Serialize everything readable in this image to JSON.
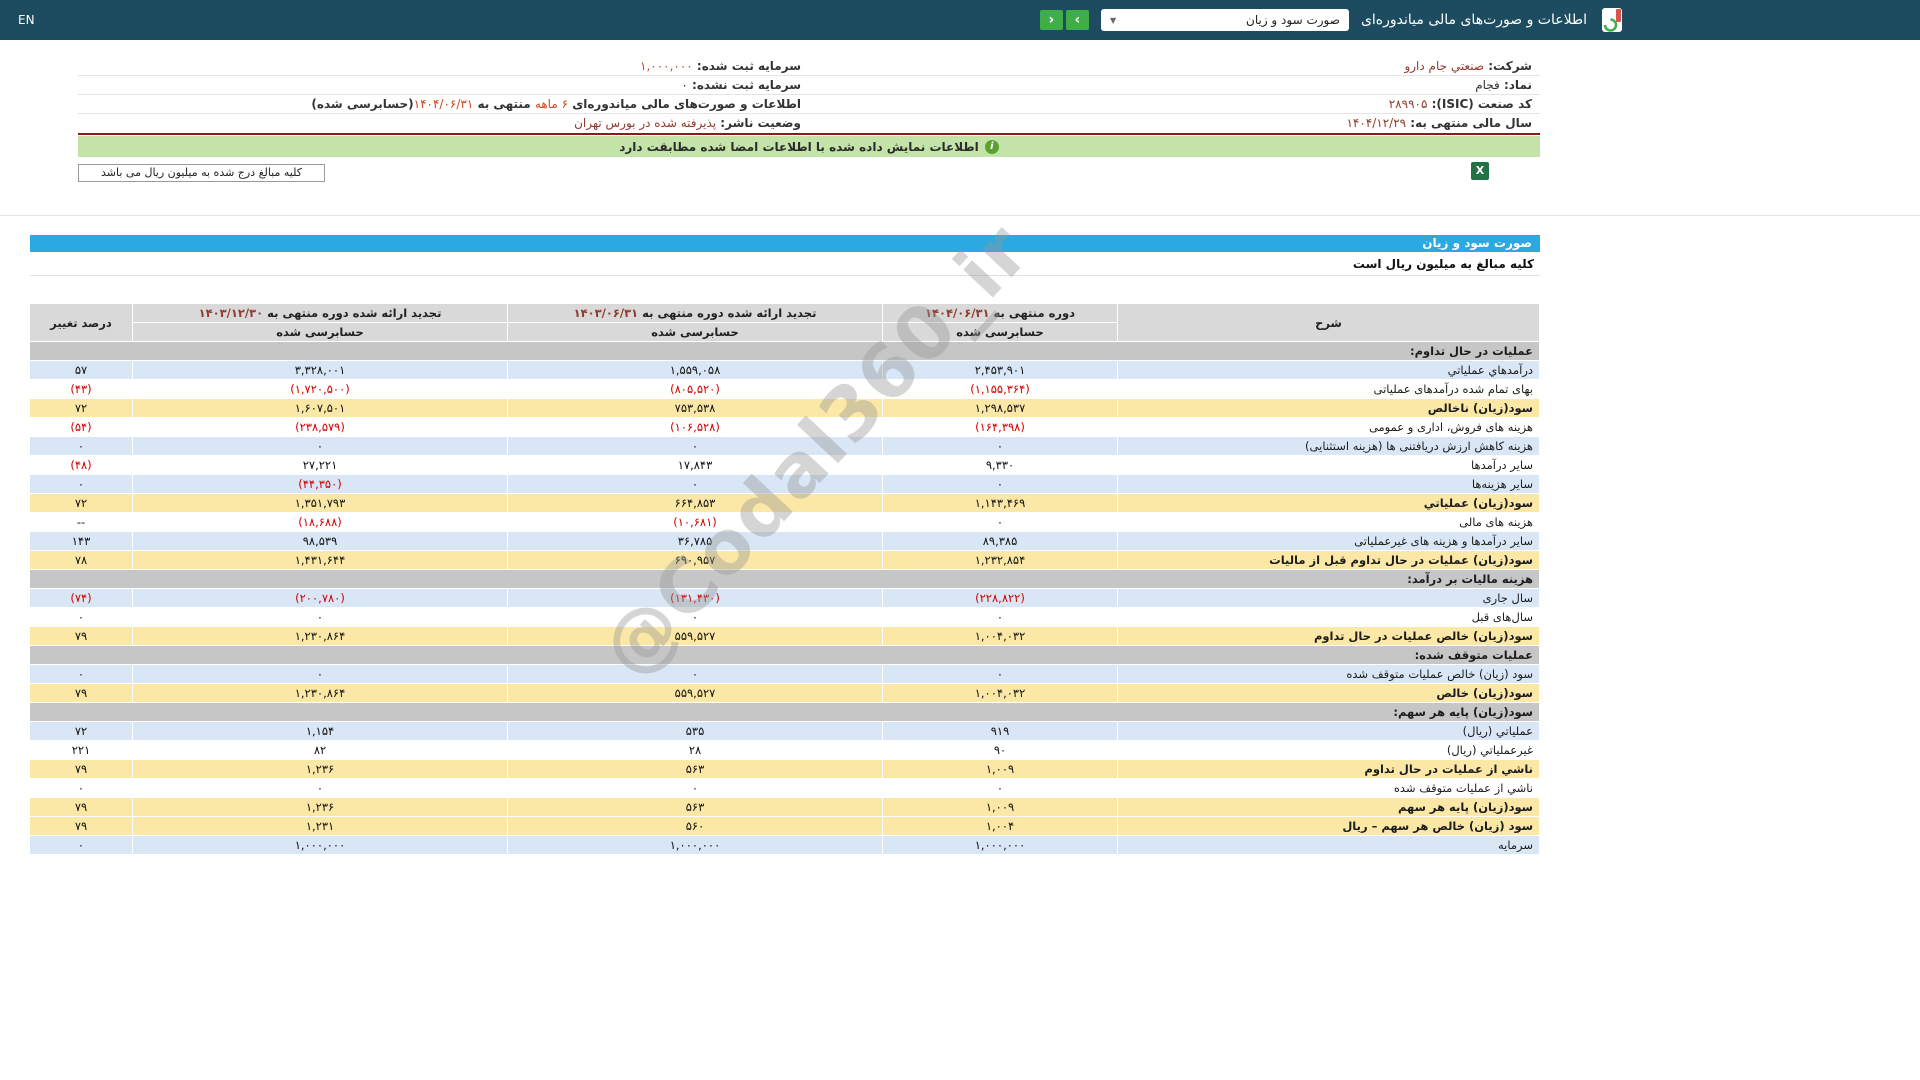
{
  "topbar": {
    "title": "اطلاعات و صورت‌های مالی میاندوره‌ای",
    "report_select_value": "صورت سود و زیان",
    "select_caret": "▼",
    "next_button": "›",
    "prev_button": "‹",
    "en_link": "EN"
  },
  "company_info": {
    "rows": [
      {
        "right": [
          {
            "text": "شرکت: ",
            "style": "label"
          },
          {
            "text": "صنعتي جام دارو",
            "style": "maroon"
          }
        ],
        "left": [
          {
            "text": "سرمایه ثبت شده: ",
            "style": "label"
          },
          {
            "text": "۱,۰۰۰,۰۰۰",
            "style": "orange"
          }
        ]
      },
      {
        "right": [
          {
            "text": "نماد: ",
            "style": "label"
          },
          {
            "text": "فجام",
            "style": "dark"
          }
        ],
        "left": [
          {
            "text": "سرمایه ثبت نشده: ",
            "style": "label"
          },
          {
            "text": "۰",
            "style": "dark"
          }
        ]
      },
      {
        "right": [
          {
            "text": "کد صنعت (ISIC): ",
            "style": "label"
          },
          {
            "text": "۲۸۹۹۰۵",
            "style": "maroon"
          }
        ],
        "left": [
          {
            "text": "اطلاعات و صورت‌های مالی میاندوره‌ای ",
            "style": "label"
          },
          {
            "text": "۶ ماهه",
            "style": "orange"
          },
          {
            "text": " منتهی به ",
            "style": "label"
          },
          {
            "text": "۱۴۰۴/۰۶/۳۱",
            "style": "orange"
          },
          {
            "text": "(حسابرسی شده)",
            "style": "label"
          }
        ]
      },
      {
        "right": [
          {
            "text": "سال مالی منتهی به: ",
            "style": "label"
          },
          {
            "text": "۱۴۰۴/۱۲/۲۹",
            "style": "maroon"
          }
        ],
        "left": [
          {
            "text": "وضعیت ناشر: ",
            "style": "label"
          },
          {
            "text": "پذیرفته شده در بورس تهران",
            "style": "maroon"
          }
        ]
      }
    ]
  },
  "alert": {
    "icon_glyph": "i",
    "text": "اطلاعات نمایش داده شده با اطلاعات امضا شده مطابقت دارد"
  },
  "unit_note": "کلیه مبالغ درج شده به میلیون ریال می باشد",
  "icons": {
    "excel_glyph": "X"
  },
  "statement": {
    "title": "صورت سود و زیان",
    "unit_line": "کلیه مبالغ به میلیون ریال است",
    "watermark": "@Codal360_ir",
    "table": {
      "headers": {
        "desc": "شرح",
        "audited": "حسابرسی شده",
        "change": "درصد تغییر"
      },
      "columns": [
        {
          "prefix": "دوره منتهی به ",
          "date": "۱۴۰۴/۰۶/۳۱"
        },
        {
          "prefix": "تجدید ارائه شده دوره منتهی به ",
          "date": "۱۴۰۳/۰۶/۳۱"
        },
        {
          "prefix": "تجدید ارائه شده دوره منتهی به ",
          "date": "۱۴۰۳/۱۲/۳۰"
        }
      ],
      "rows": [
        {
          "section": true,
          "label": "عملیات در حال تداوم:"
        },
        {
          "label": "درآمدهاي عملياتي",
          "bg": "blue",
          "values": [
            "۲,۴۵۳,۹۰۱",
            "۱,۵۵۹,۰۵۸",
            "۳,۳۲۸,۰۰۱",
            "۵۷"
          ]
        },
        {
          "label": "بهای تمام شده درآمدهای عملیاتی",
          "bg": "white",
          "values": [
            "(۱,۱۵۵,۳۶۴)",
            "(۸۰۵,۵۲۰)",
            "(۱,۷۲۰,۵۰۰)",
            "(۴۳)"
          ]
        },
        {
          "label": "سود(زیان) ناخالص",
          "bg": "yellow",
          "values": [
            "۱,۲۹۸,۵۳۷",
            "۷۵۳,۵۳۸",
            "۱,۶۰۷,۵۰۱",
            "۷۲"
          ]
        },
        {
          "label": "هزینه های فروش، اداری و عمومی",
          "bg": "white",
          "values": [
            "(۱۶۴,۳۹۸)",
            "(۱۰۶,۵۲۸)",
            "(۲۳۸,۵۷۹)",
            "(۵۴)"
          ]
        },
        {
          "label": "هزینه کاهش ارزش دریافتنی ها (هزینه استثنایی)",
          "bg": "blue",
          "values": [
            "۰",
            "۰",
            "۰",
            "۰"
          ]
        },
        {
          "label": "سایر درآمدها",
          "bg": "white",
          "values": [
            "۹,۳۳۰",
            "۱۷,۸۴۳",
            "۲۷,۲۲۱",
            "(۴۸)"
          ]
        },
        {
          "label": "سایر هزینه‌ها",
          "bg": "blue",
          "values": [
            "۰",
            "۰",
            "(۴۴,۳۵۰)",
            "۰"
          ]
        },
        {
          "label": "سود(زیان) عملیاتي",
          "bg": "yellow",
          "values": [
            "۱,۱۴۳,۴۶۹",
            "۶۶۴,۸۵۳",
            "۱,۳۵۱,۷۹۳",
            "۷۲"
          ]
        },
        {
          "label": "هزینه های مالی",
          "bg": "white",
          "values": [
            "۰",
            "(۱۰,۶۸۱)",
            "(۱۸,۶۸۸)",
            "--"
          ]
        },
        {
          "label": "سایر درآمدها و هزینه های غیرعملیاتی",
          "bg": "blue",
          "values": [
            "۸۹,۳۸۵",
            "۳۶,۷۸۵",
            "۹۸,۵۳۹",
            "۱۴۳"
          ]
        },
        {
          "label": "سود(زیان) عملیات در حال تداوم قبل از مالیات",
          "bg": "yellow",
          "values": [
            "۱,۲۳۲,۸۵۴",
            "۶۹۰,۹۵۷",
            "۱,۴۳۱,۶۴۴",
            "۷۸"
          ]
        },
        {
          "section": true,
          "label": "هزینه مالیات بر درآمد:"
        },
        {
          "label": "سال جاری",
          "bg": "blue",
          "values": [
            "(۲۲۸,۸۲۲)",
            "(۱۳۱,۴۳۰)",
            "(۲۰۰,۷۸۰)",
            "(۷۴)"
          ]
        },
        {
          "label": "سال‌های قبل",
          "bg": "white",
          "values": [
            "۰",
            "۰",
            "۰",
            "۰"
          ]
        },
        {
          "label": "سود(زیان) خالص عملیات در حال تداوم",
          "bg": "yellow",
          "values": [
            "۱,۰۰۴,۰۳۲",
            "۵۵۹,۵۲۷",
            "۱,۲۳۰,۸۶۴",
            "۷۹"
          ]
        },
        {
          "section": true,
          "label": "عملیات متوقف شده:"
        },
        {
          "label": "سود (زیان) خالص عملیات متوقف شده",
          "bg": "blue",
          "values": [
            "۰",
            "۰",
            "۰",
            "۰"
          ]
        },
        {
          "label": "سود(زیان) خالص",
          "bg": "yellow",
          "values": [
            "۱,۰۰۴,۰۳۲",
            "۵۵۹,۵۲۷",
            "۱,۲۳۰,۸۶۴",
            "۷۹"
          ]
        },
        {
          "section": true,
          "label": "سود(زیان) پایه هر سهم:"
        },
        {
          "label": "عملیاتي (ریال)",
          "bg": "blue",
          "values": [
            "۹۱۹",
            "۵۳۵",
            "۱,۱۵۴",
            "۷۲"
          ]
        },
        {
          "label": "غیرعملیاتي (ریال)",
          "bg": "white",
          "values": [
            "۹۰",
            "۲۸",
            "۸۲",
            "۲۲۱"
          ]
        },
        {
          "label": "ناشي از عملیات در حال تداوم",
          "bg": "yellow",
          "values": [
            "۱,۰۰۹",
            "۵۶۳",
            "۱,۲۳۶",
            "۷۹"
          ]
        },
        {
          "label": "ناشي از عملیات متوقف شده",
          "bg": "white",
          "values": [
            "۰",
            "۰",
            "۰",
            "۰"
          ]
        },
        {
          "label": "سود(زیان) پایه هر سهم",
          "bg": "yellow",
          "values": [
            "۱,۰۰۹",
            "۵۶۳",
            "۱,۲۳۶",
            "۷۹"
          ]
        },
        {
          "label": "سود (زیان) خالص هر سهم – ریال",
          "bg": "yellow",
          "values": [
            "۱,۰۰۴",
            "۵۶۰",
            "۱,۲۳۱",
            "۷۹"
          ]
        },
        {
          "label": "سرمایه",
          "bg": "blue",
          "values": [
            "۱,۰۰۰,۰۰۰",
            "۱,۰۰۰,۰۰۰",
            "۱,۰۰۰,۰۰۰",
            "۰"
          ]
        }
      ]
    }
  },
  "colors": {
    "topbar_bg": "#1d4b5f",
    "accent_green": "#3fae49",
    "statement_bar_blue": "#2baae1",
    "row_blue": "#d8e6f6",
    "row_yellow": "#fce8a6",
    "row_section_gray": "#c6c6c6",
    "table_header_gray": "#d9d9d9",
    "negative_red": "#d10000",
    "company_value_maroon": "#8f3b2d",
    "company_value_red": "#cc4a21",
    "alert_green_bg": "#c3e3a8",
    "company_divider_red": "#8b1a1a"
  }
}
